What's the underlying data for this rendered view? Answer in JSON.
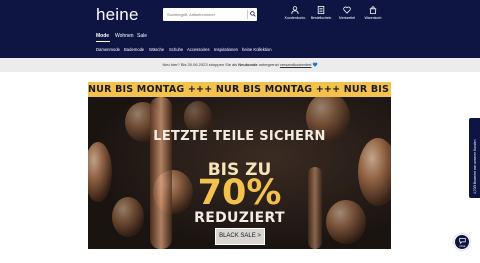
{
  "header": {
    "logo": "heine",
    "search": {
      "placeholder": "Suchbegriff, Artikelnummer"
    },
    "icons": [
      {
        "name": "account-icon",
        "label": "Kundenkonto"
      },
      {
        "name": "order-icon",
        "label": "Bestellschein"
      },
      {
        "name": "wishlist-icon",
        "label": "Merkzettel"
      },
      {
        "name": "cart-icon",
        "label": "Warenkorb"
      }
    ],
    "main_tabs": [
      {
        "label": "Mode",
        "active": true
      },
      {
        "label": "Wohnen",
        "active": false
      },
      {
        "label": "Sale",
        "active": false
      }
    ],
    "categories": [
      "Damenmode",
      "Bademode",
      "Wäsche",
      "Schuhe",
      "Accessoires",
      "Inspirationen",
      "heine Kollektion"
    ]
  },
  "promo_bar": {
    "prefix": "Neu hier? Bis 30.06.2023 shoppen Sie als ",
    "bold": "Neukunde",
    "middle": " unbegrenzt ",
    "link": "versandkostenfrei",
    "suffix": " 💙"
  },
  "banner": {
    "ticker": "NUR BIS MONTAG +++ NUR BIS MONTAG +++ NUR BIS MONTAG",
    "headline": "LETZTE TEILE SICHERN",
    "line2": "BIS ZU",
    "percent": "70%",
    "line4": "REDUZIERT",
    "cta": "BLACK SALE >"
  },
  "side_tab": {
    "label": "4,70/5 Bewertet von unseren Kunden"
  },
  "chat": {
    "label": "Chat"
  },
  "colors": {
    "header_bg": "#0e1543",
    "ticker_bg": "#f2c14e",
    "promo_bg": "#ececec"
  }
}
